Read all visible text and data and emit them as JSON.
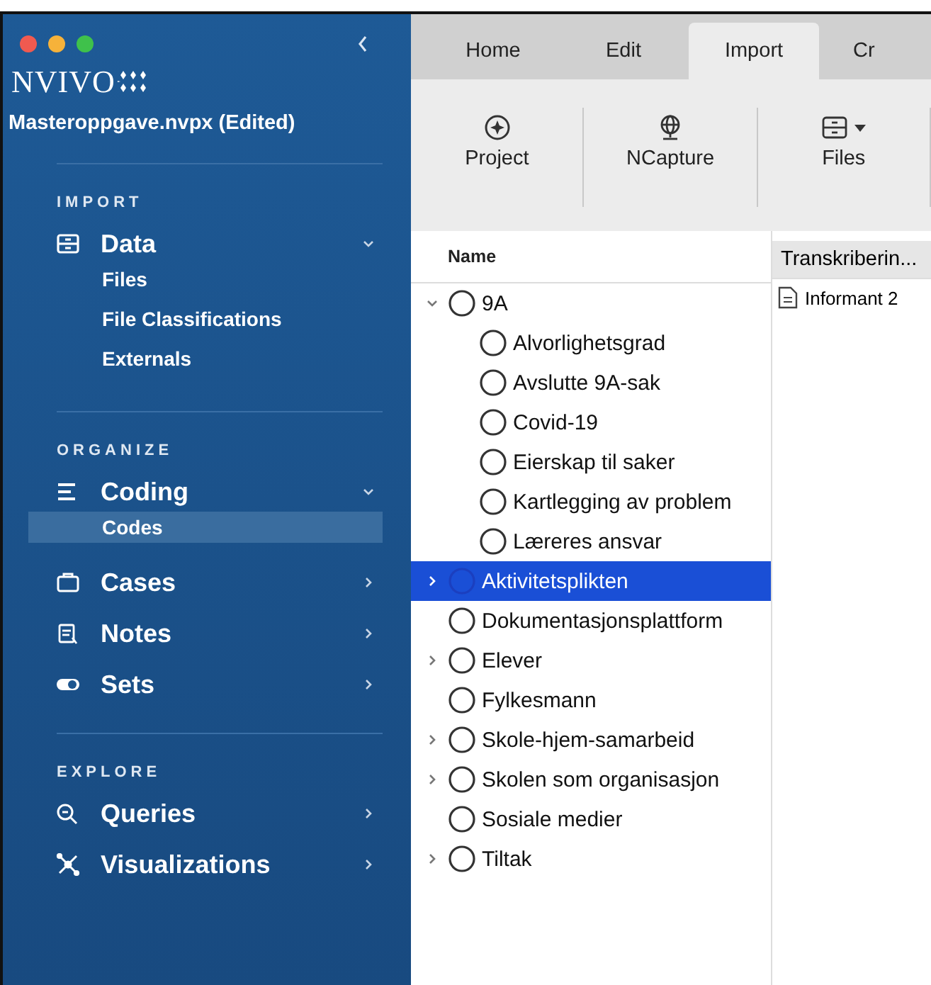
{
  "sidebar": {
    "logo": "NVIVO",
    "project": "Masteroppgave.nvpx (Edited)",
    "sections": [
      {
        "heading": "IMPORT",
        "items": [
          {
            "label": "Data",
            "expanded": true,
            "children": [
              {
                "label": "Files",
                "selected": false
              },
              {
                "label": "File Classifications",
                "selected": false
              },
              {
                "label": "Externals",
                "selected": false
              }
            ]
          }
        ]
      },
      {
        "heading": "ORGANIZE",
        "items": [
          {
            "label": "Coding",
            "expanded": true,
            "children": [
              {
                "label": "Codes",
                "selected": true
              }
            ]
          },
          {
            "label": "Cases",
            "expanded": false
          },
          {
            "label": "Notes",
            "expanded": false
          },
          {
            "label": "Sets",
            "expanded": false
          }
        ]
      },
      {
        "heading": "EXPLORE",
        "items": [
          {
            "label": "Queries",
            "expanded": false
          },
          {
            "label": "Visualizations",
            "expanded": false
          }
        ]
      }
    ]
  },
  "ribbon": {
    "tabs": [
      {
        "label": "Home",
        "selected": false
      },
      {
        "label": "Edit",
        "selected": false
      },
      {
        "label": "Import",
        "selected": true
      },
      {
        "label": "Cr",
        "selected": false
      }
    ],
    "buttons": [
      {
        "label": "Project",
        "dropdown": false
      },
      {
        "label": "NCapture",
        "dropdown": false
      },
      {
        "label": "Files",
        "dropdown": true
      }
    ]
  },
  "tree": {
    "column": "Name",
    "nodes": [
      {
        "label": "9A",
        "selected": false,
        "expanded": true,
        "children": [
          {
            "label": "Alvorlighetsgrad",
            "selected": false
          },
          {
            "label": "Avslutte 9A-sak",
            "selected": false
          },
          {
            "label": "Covid-19",
            "selected": false
          },
          {
            "label": "Eierskap til saker",
            "selected": false
          },
          {
            "label": "Kartlegging av problem",
            "selected": false
          },
          {
            "label": "Læreres ansvar",
            "selected": false
          }
        ]
      },
      {
        "label": "Aktivitetsplikten",
        "selected": true,
        "expanded": false
      },
      {
        "label": "Dokumentasjonsplattform",
        "selected": false
      },
      {
        "label": "Elever",
        "selected": false,
        "expanded": false
      },
      {
        "label": "Fylkesmann",
        "selected": false
      },
      {
        "label": "Skole-hjem-samarbeid",
        "selected": false,
        "expanded": false
      },
      {
        "label": "Skolen som organisasjon",
        "selected": false,
        "expanded": false
      },
      {
        "label": "Sosiale medier",
        "selected": false
      },
      {
        "label": "Tiltak",
        "selected": false,
        "expanded": false
      }
    ]
  },
  "detail": {
    "column": "Transkriberin...",
    "rows": [
      "Informant 2"
    ]
  }
}
